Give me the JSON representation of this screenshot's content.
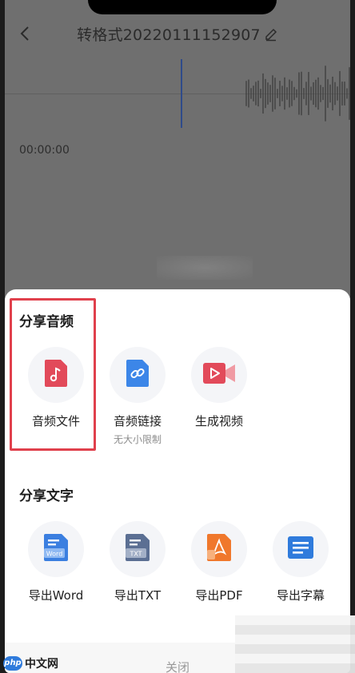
{
  "header": {
    "title": "转格式20220111152907"
  },
  "player": {
    "time": "00:00:00"
  },
  "share_audio": {
    "title": "分享音频",
    "items": [
      {
        "label": "音频文件",
        "sub": ""
      },
      {
        "label": "音频链接",
        "sub": "无大小限制"
      },
      {
        "label": "生成视频",
        "sub": ""
      }
    ]
  },
  "share_text": {
    "title": "分享文字",
    "items": [
      {
        "label": "导出Word"
      },
      {
        "label": "导出TXT"
      },
      {
        "label": "导出PDF"
      },
      {
        "label": "导出字幕"
      }
    ]
  },
  "icons": {
    "word_badge": "Word",
    "txt_badge": "TXT"
  },
  "footer": {
    "close_label": "关闭"
  },
  "watermark": {
    "logo": "php",
    "text": "中文网"
  },
  "colors": {
    "accent_red": "#e0404c",
    "audio_icon": "#e24a5a",
    "link_icon": "#3c86e8",
    "word_icon": "#3b7fe0",
    "txt_icon": "#5b6f93",
    "pdf_icon": "#f0782c",
    "subtitle_icon": "#2f7bdc"
  }
}
